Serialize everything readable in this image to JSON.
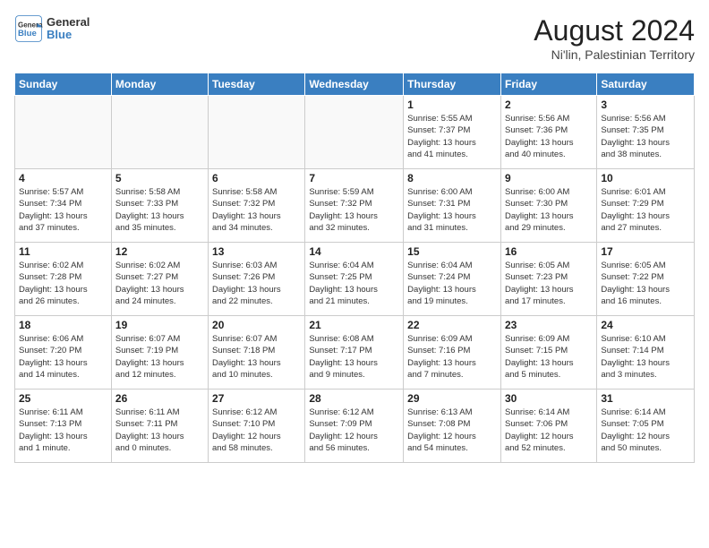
{
  "logo": {
    "line1": "General",
    "line2": "Blue"
  },
  "title": {
    "month_year": "August 2024",
    "location": "Ni'lin, Palestinian Territory"
  },
  "weekdays": [
    "Sunday",
    "Monday",
    "Tuesday",
    "Wednesday",
    "Thursday",
    "Friday",
    "Saturday"
  ],
  "weeks": [
    [
      {
        "day": "",
        "empty": true
      },
      {
        "day": "",
        "empty": true
      },
      {
        "day": "",
        "empty": true
      },
      {
        "day": "",
        "empty": true
      },
      {
        "day": "1",
        "info": "Sunrise: 5:55 AM\nSunset: 7:37 PM\nDaylight: 13 hours\nand 41 minutes."
      },
      {
        "day": "2",
        "info": "Sunrise: 5:56 AM\nSunset: 7:36 PM\nDaylight: 13 hours\nand 40 minutes."
      },
      {
        "day": "3",
        "info": "Sunrise: 5:56 AM\nSunset: 7:35 PM\nDaylight: 13 hours\nand 38 minutes."
      }
    ],
    [
      {
        "day": "4",
        "info": "Sunrise: 5:57 AM\nSunset: 7:34 PM\nDaylight: 13 hours\nand 37 minutes."
      },
      {
        "day": "5",
        "info": "Sunrise: 5:58 AM\nSunset: 7:33 PM\nDaylight: 13 hours\nand 35 minutes."
      },
      {
        "day": "6",
        "info": "Sunrise: 5:58 AM\nSunset: 7:32 PM\nDaylight: 13 hours\nand 34 minutes."
      },
      {
        "day": "7",
        "info": "Sunrise: 5:59 AM\nSunset: 7:32 PM\nDaylight: 13 hours\nand 32 minutes."
      },
      {
        "day": "8",
        "info": "Sunrise: 6:00 AM\nSunset: 7:31 PM\nDaylight: 13 hours\nand 31 minutes."
      },
      {
        "day": "9",
        "info": "Sunrise: 6:00 AM\nSunset: 7:30 PM\nDaylight: 13 hours\nand 29 minutes."
      },
      {
        "day": "10",
        "info": "Sunrise: 6:01 AM\nSunset: 7:29 PM\nDaylight: 13 hours\nand 27 minutes."
      }
    ],
    [
      {
        "day": "11",
        "info": "Sunrise: 6:02 AM\nSunset: 7:28 PM\nDaylight: 13 hours\nand 26 minutes."
      },
      {
        "day": "12",
        "info": "Sunrise: 6:02 AM\nSunset: 7:27 PM\nDaylight: 13 hours\nand 24 minutes."
      },
      {
        "day": "13",
        "info": "Sunrise: 6:03 AM\nSunset: 7:26 PM\nDaylight: 13 hours\nand 22 minutes."
      },
      {
        "day": "14",
        "info": "Sunrise: 6:04 AM\nSunset: 7:25 PM\nDaylight: 13 hours\nand 21 minutes."
      },
      {
        "day": "15",
        "info": "Sunrise: 6:04 AM\nSunset: 7:24 PM\nDaylight: 13 hours\nand 19 minutes."
      },
      {
        "day": "16",
        "info": "Sunrise: 6:05 AM\nSunset: 7:23 PM\nDaylight: 13 hours\nand 17 minutes."
      },
      {
        "day": "17",
        "info": "Sunrise: 6:05 AM\nSunset: 7:22 PM\nDaylight: 13 hours\nand 16 minutes."
      }
    ],
    [
      {
        "day": "18",
        "info": "Sunrise: 6:06 AM\nSunset: 7:20 PM\nDaylight: 13 hours\nand 14 minutes."
      },
      {
        "day": "19",
        "info": "Sunrise: 6:07 AM\nSunset: 7:19 PM\nDaylight: 13 hours\nand 12 minutes."
      },
      {
        "day": "20",
        "info": "Sunrise: 6:07 AM\nSunset: 7:18 PM\nDaylight: 13 hours\nand 10 minutes."
      },
      {
        "day": "21",
        "info": "Sunrise: 6:08 AM\nSunset: 7:17 PM\nDaylight: 13 hours\nand 9 minutes."
      },
      {
        "day": "22",
        "info": "Sunrise: 6:09 AM\nSunset: 7:16 PM\nDaylight: 13 hours\nand 7 minutes."
      },
      {
        "day": "23",
        "info": "Sunrise: 6:09 AM\nSunset: 7:15 PM\nDaylight: 13 hours\nand 5 minutes."
      },
      {
        "day": "24",
        "info": "Sunrise: 6:10 AM\nSunset: 7:14 PM\nDaylight: 13 hours\nand 3 minutes."
      }
    ],
    [
      {
        "day": "25",
        "info": "Sunrise: 6:11 AM\nSunset: 7:13 PM\nDaylight: 13 hours\nand 1 minute."
      },
      {
        "day": "26",
        "info": "Sunrise: 6:11 AM\nSunset: 7:11 PM\nDaylight: 13 hours\nand 0 minutes."
      },
      {
        "day": "27",
        "info": "Sunrise: 6:12 AM\nSunset: 7:10 PM\nDaylight: 12 hours\nand 58 minutes."
      },
      {
        "day": "28",
        "info": "Sunrise: 6:12 AM\nSunset: 7:09 PM\nDaylight: 12 hours\nand 56 minutes."
      },
      {
        "day": "29",
        "info": "Sunrise: 6:13 AM\nSunset: 7:08 PM\nDaylight: 12 hours\nand 54 minutes."
      },
      {
        "day": "30",
        "info": "Sunrise: 6:14 AM\nSunset: 7:06 PM\nDaylight: 12 hours\nand 52 minutes."
      },
      {
        "day": "31",
        "info": "Sunrise: 6:14 AM\nSunset: 7:05 PM\nDaylight: 12 hours\nand 50 minutes."
      }
    ]
  ]
}
